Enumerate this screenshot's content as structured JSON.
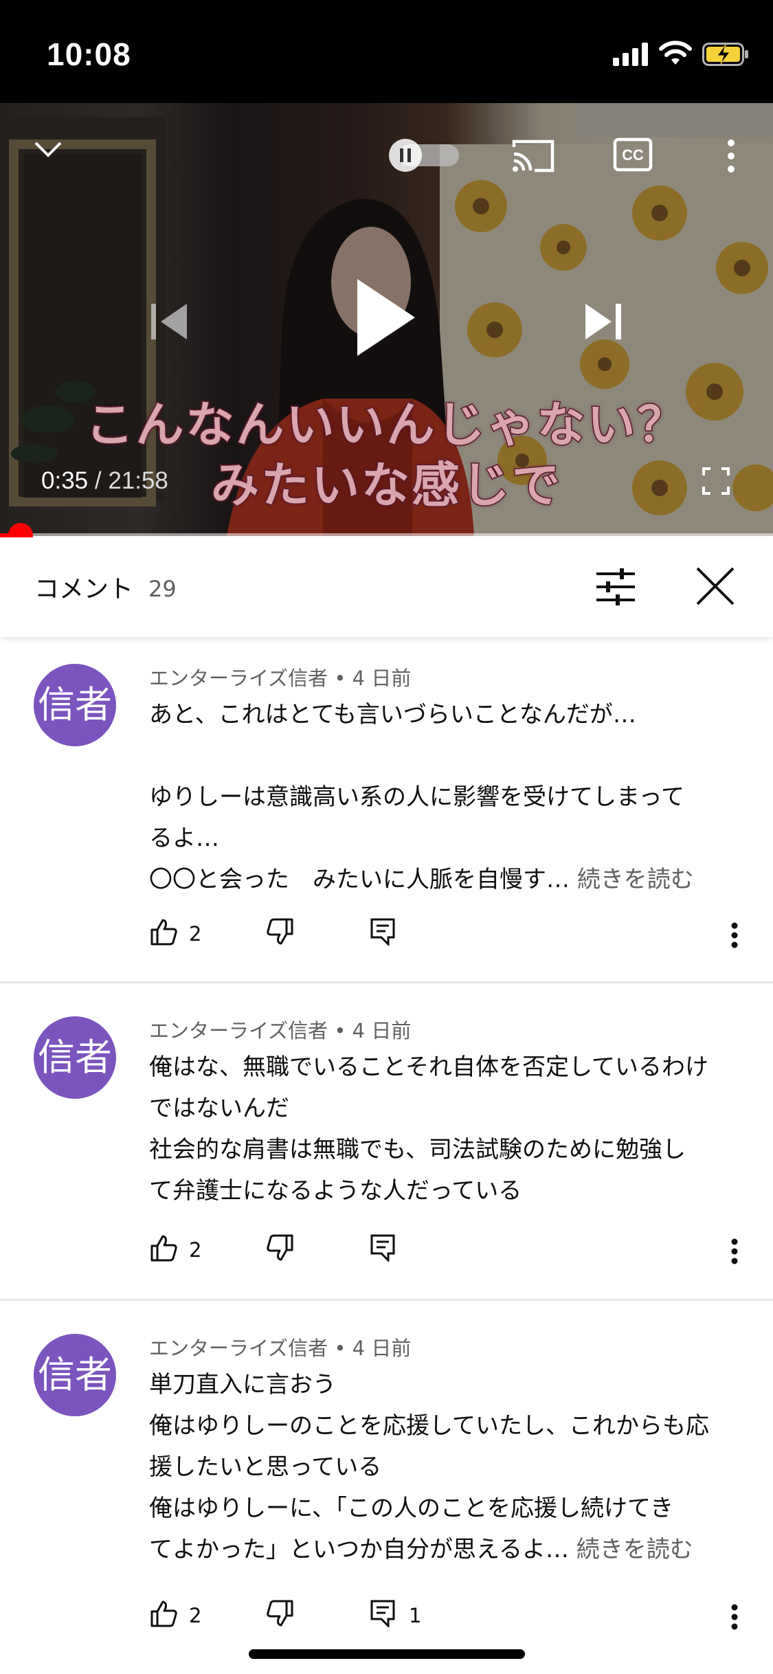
{
  "status_bar": {
    "time": "10:08"
  },
  "player": {
    "subtitle_line1": "こんなんいいんじゃない？",
    "subtitle_line2": "みたいな感じで",
    "current_time": "0:35",
    "separator": " / ",
    "duration": "21:58",
    "progress": 0.027
  },
  "comments_panel": {
    "title": "コメント",
    "count": "29"
  },
  "comments": [
    {
      "avatar": "信者",
      "meta": "エンターライズ信者 • 4 日前",
      "lines": [
        "あと、これはとても言いづらいことなんだが…",
        "",
        "ゆりしーは意識高い系の人に影響を受けてしまって",
        "るよ…",
        "〇〇と会った　みたいに人脈を自慢す…"
      ],
      "read_more": "続きを読む",
      "likes": "2",
      "replies": ""
    },
    {
      "avatar": "信者",
      "meta": "エンターライズ信者 • 4 日前",
      "lines": [
        "俺はな、無職でいることそれ自体を否定しているわけ",
        "ではないんだ",
        "社会的な肩書は無職でも、司法試験のために勉強し",
        "て弁護士になるような人だっている"
      ],
      "read_more": "",
      "likes": "2",
      "replies": ""
    },
    {
      "avatar": "信者",
      "meta": "エンターライズ信者 • 4 日前",
      "lines": [
        "単刀直入に言おう",
        "俺はゆりしーのことを応援していたし、これからも応",
        "援したいと思っている",
        "俺はゆりしーに、「この人のことを応援し続けてき",
        "てよかった」といつか自分が思えるよ…"
      ],
      "read_more": "続きを読む",
      "likes": "2",
      "replies": "1"
    }
  ]
}
